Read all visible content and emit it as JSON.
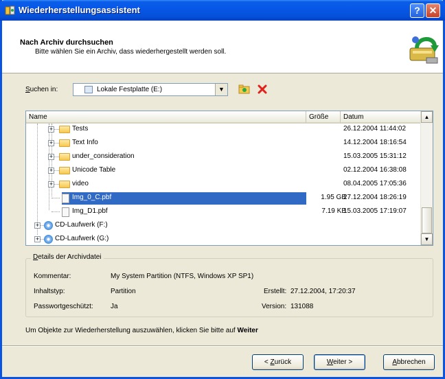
{
  "window": {
    "title": "Wiederherstellungsassistent",
    "help_glyph": "?",
    "close_glyph": "✕"
  },
  "header": {
    "title": "Nach Archiv durchsuchen",
    "subtitle": "Bitte wählen Sie ein Archiv, dass wiederhergestellt werden soll."
  },
  "search": {
    "label_accel": "S",
    "label_rest": "uchen in:",
    "value": "Lokale Festplatte (E:)"
  },
  "columns": {
    "name": "Name",
    "size": "Größe",
    "date": "Datum"
  },
  "tree": [
    {
      "name": "Tests",
      "type": "folder",
      "size": "",
      "date": "26.12.2004 11:44:02"
    },
    {
      "name": "Text Info",
      "type": "folder",
      "size": "",
      "date": "14.12.2004 18:16:54"
    },
    {
      "name": "under_consideration",
      "type": "folder",
      "size": "",
      "date": "15.03.2005 15:31:12"
    },
    {
      "name": "Unicode Table",
      "type": "folder",
      "size": "",
      "date": "02.12.2004 16:38:08"
    },
    {
      "name": "video",
      "type": "folder",
      "size": "",
      "date": "08.04.2005 17:05:36"
    },
    {
      "name": "Img_0_C.pbf",
      "type": "file",
      "size": "1.95 GB",
      "date": "27.12.2004 18:26:19",
      "selected": true
    },
    {
      "name": "Img_D1.pbf",
      "type": "file",
      "size": "7.19 KB",
      "date": "15.03.2005 17:19:07"
    },
    {
      "name": "CD-Laufwerk (F:)",
      "type": "cd",
      "size": "",
      "date": ""
    },
    {
      "name": "CD-Laufwerk (G:)",
      "type": "cd",
      "size": "",
      "date": ""
    }
  ],
  "details": {
    "title_accel": "D",
    "title_rest": "etails der Archivdatei",
    "comment_label": "Kommentar:",
    "comment_value": "My System Partition (NTFS, Windows XP SP1)",
    "content_label": "Inhaltstyp:",
    "content_value": "Partition",
    "created_label": "Erstellt:",
    "created_value": "27.12.2004, 17:20:37",
    "password_label": "Passwortgeschützt:",
    "password_value": "Ja",
    "version_label": "Version:",
    "version_value": "131088"
  },
  "hint": {
    "text": "Um Objekte zur Wiederherstellung auszuwählen, klicken Sie bitte auf ",
    "bold": "Weiter"
  },
  "buttons": {
    "back_prefix": "< ",
    "back_accel": "Z",
    "back_rest": "urück",
    "next_accel": "W",
    "next_rest": "eiter >",
    "cancel_accel": "A",
    "cancel_rest": "bbrechen"
  },
  "colors": {
    "selection": "#316ac5",
    "titlebar": "#0756e6"
  }
}
